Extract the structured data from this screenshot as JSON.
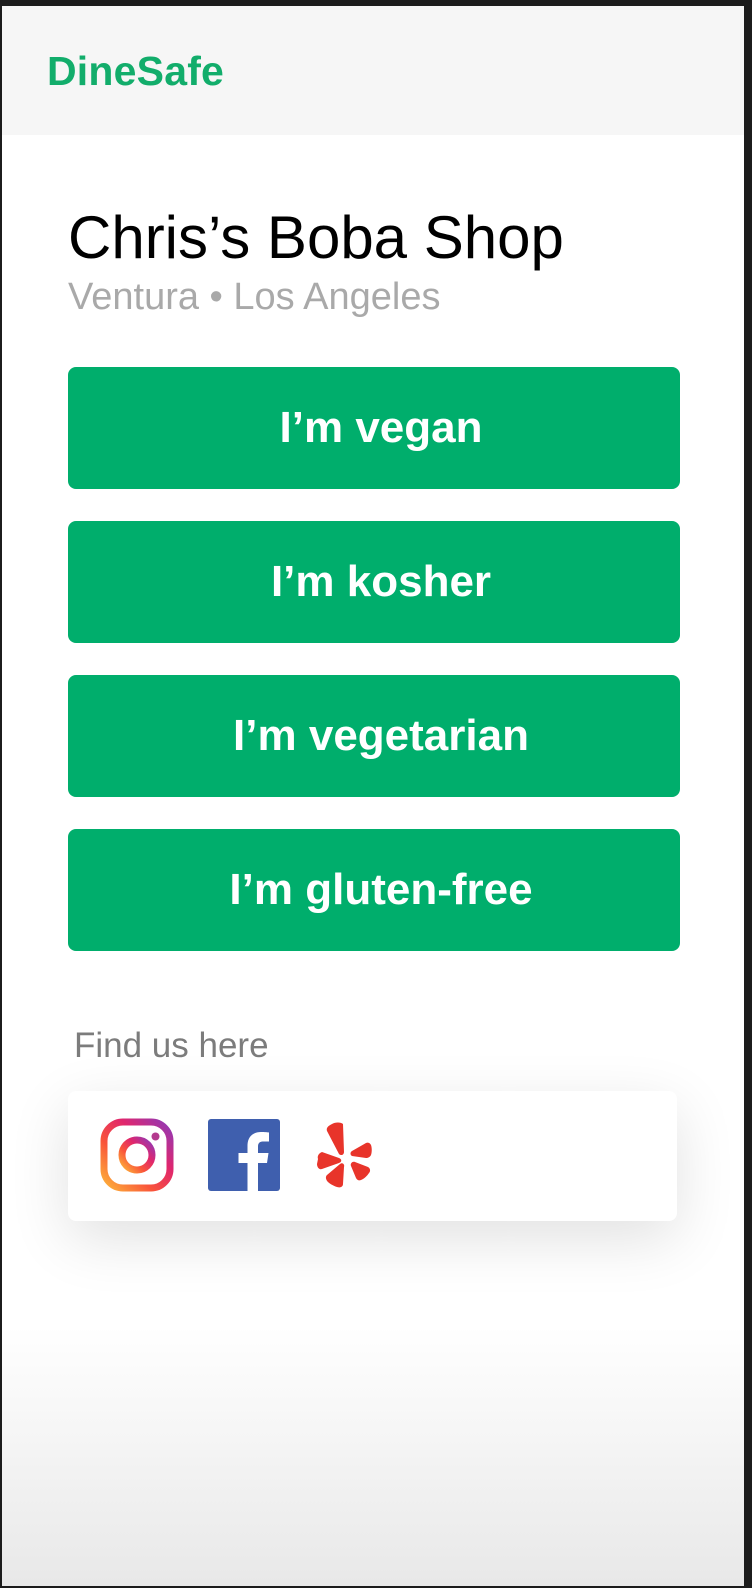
{
  "app": {
    "brand": "DineSafe",
    "brand_color": "#12ad6b"
  },
  "restaurant": {
    "name": "Chris’s Boba Shop",
    "location": "Ventura • Los Angeles"
  },
  "diet_buttons": [
    {
      "label": "I’m vegan"
    },
    {
      "label": "I’m kosher"
    },
    {
      "label": "I’m vegetarian"
    },
    {
      "label": "I’m gluten-free"
    }
  ],
  "button_color": "#00ae6c",
  "social": {
    "heading": "Find us here",
    "links": [
      {
        "icon": "instagram-icon"
      },
      {
        "icon": "facebook-icon"
      },
      {
        "icon": "yelp-icon"
      }
    ]
  }
}
